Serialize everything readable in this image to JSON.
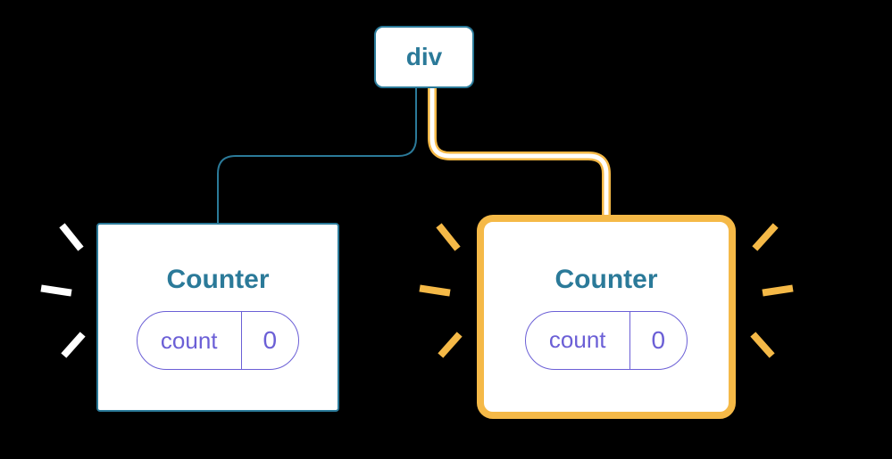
{
  "tree": {
    "root": {
      "label": "div"
    },
    "children": [
      {
        "label": "Counter",
        "highlighted": false,
        "state": {
          "name": "count",
          "value": "0"
        }
      },
      {
        "label": "Counter",
        "highlighted": true,
        "state": {
          "name": "count",
          "value": "0"
        }
      }
    ]
  },
  "colors": {
    "node_border": "#2b7a99",
    "highlight": "#f5b947",
    "state": "#6b5fd6"
  }
}
